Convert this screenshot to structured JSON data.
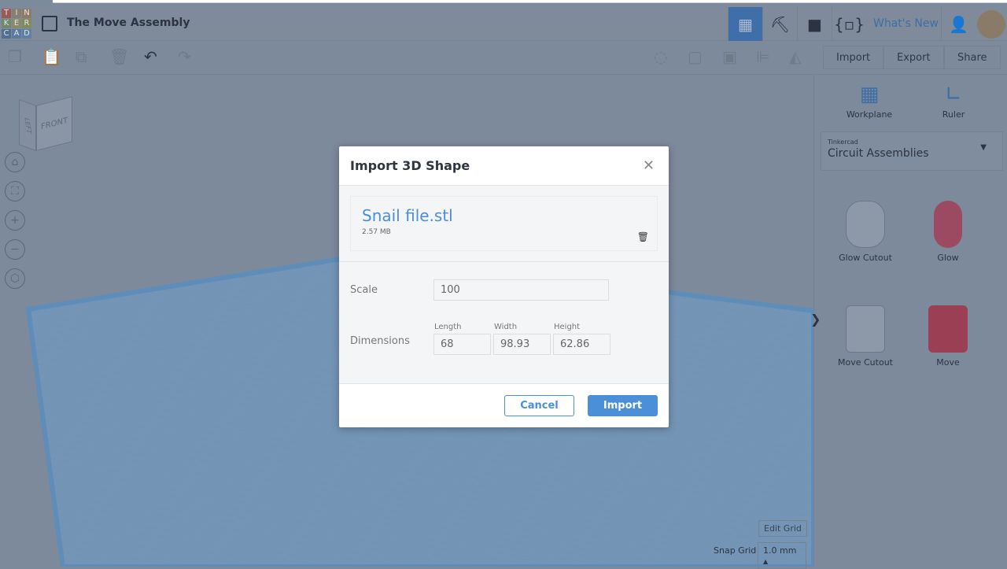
{
  "header": {
    "logo_letters": [
      "T",
      "I",
      "N",
      "K",
      "E",
      "R",
      "C",
      "A",
      "D"
    ],
    "title": "The Move Assembly",
    "whats_new": "What's New"
  },
  "toolbar": {
    "import": "Import",
    "export": "Export",
    "share": "Share"
  },
  "right_panel": {
    "workplane": "Workplane",
    "ruler": "Ruler",
    "library_source": "Tinkercad",
    "library": "Circuit Assemblies",
    "shapes": [
      "Glow Cutout",
      "Glow",
      "Move Cutout",
      "Move"
    ]
  },
  "viewcube": {
    "front": "FRONT",
    "left": "LEFT"
  },
  "grid": {
    "edit_grid": "Edit Grid",
    "snap_grid_label": "Snap Grid",
    "snap_grid_value": "1.0 mm"
  },
  "dialog": {
    "title": "Import 3D Shape",
    "file_name": "Snail file.stl",
    "file_size": "2.57 MB",
    "scale_label": "Scale",
    "scale_value": "100",
    "dimensions_label": "Dimensions",
    "length_label": "Length",
    "length": "68",
    "width_label": "Width",
    "width": "98.93",
    "height_label": "Height",
    "height": "62.86",
    "cancel": "Cancel",
    "import": "Import"
  }
}
